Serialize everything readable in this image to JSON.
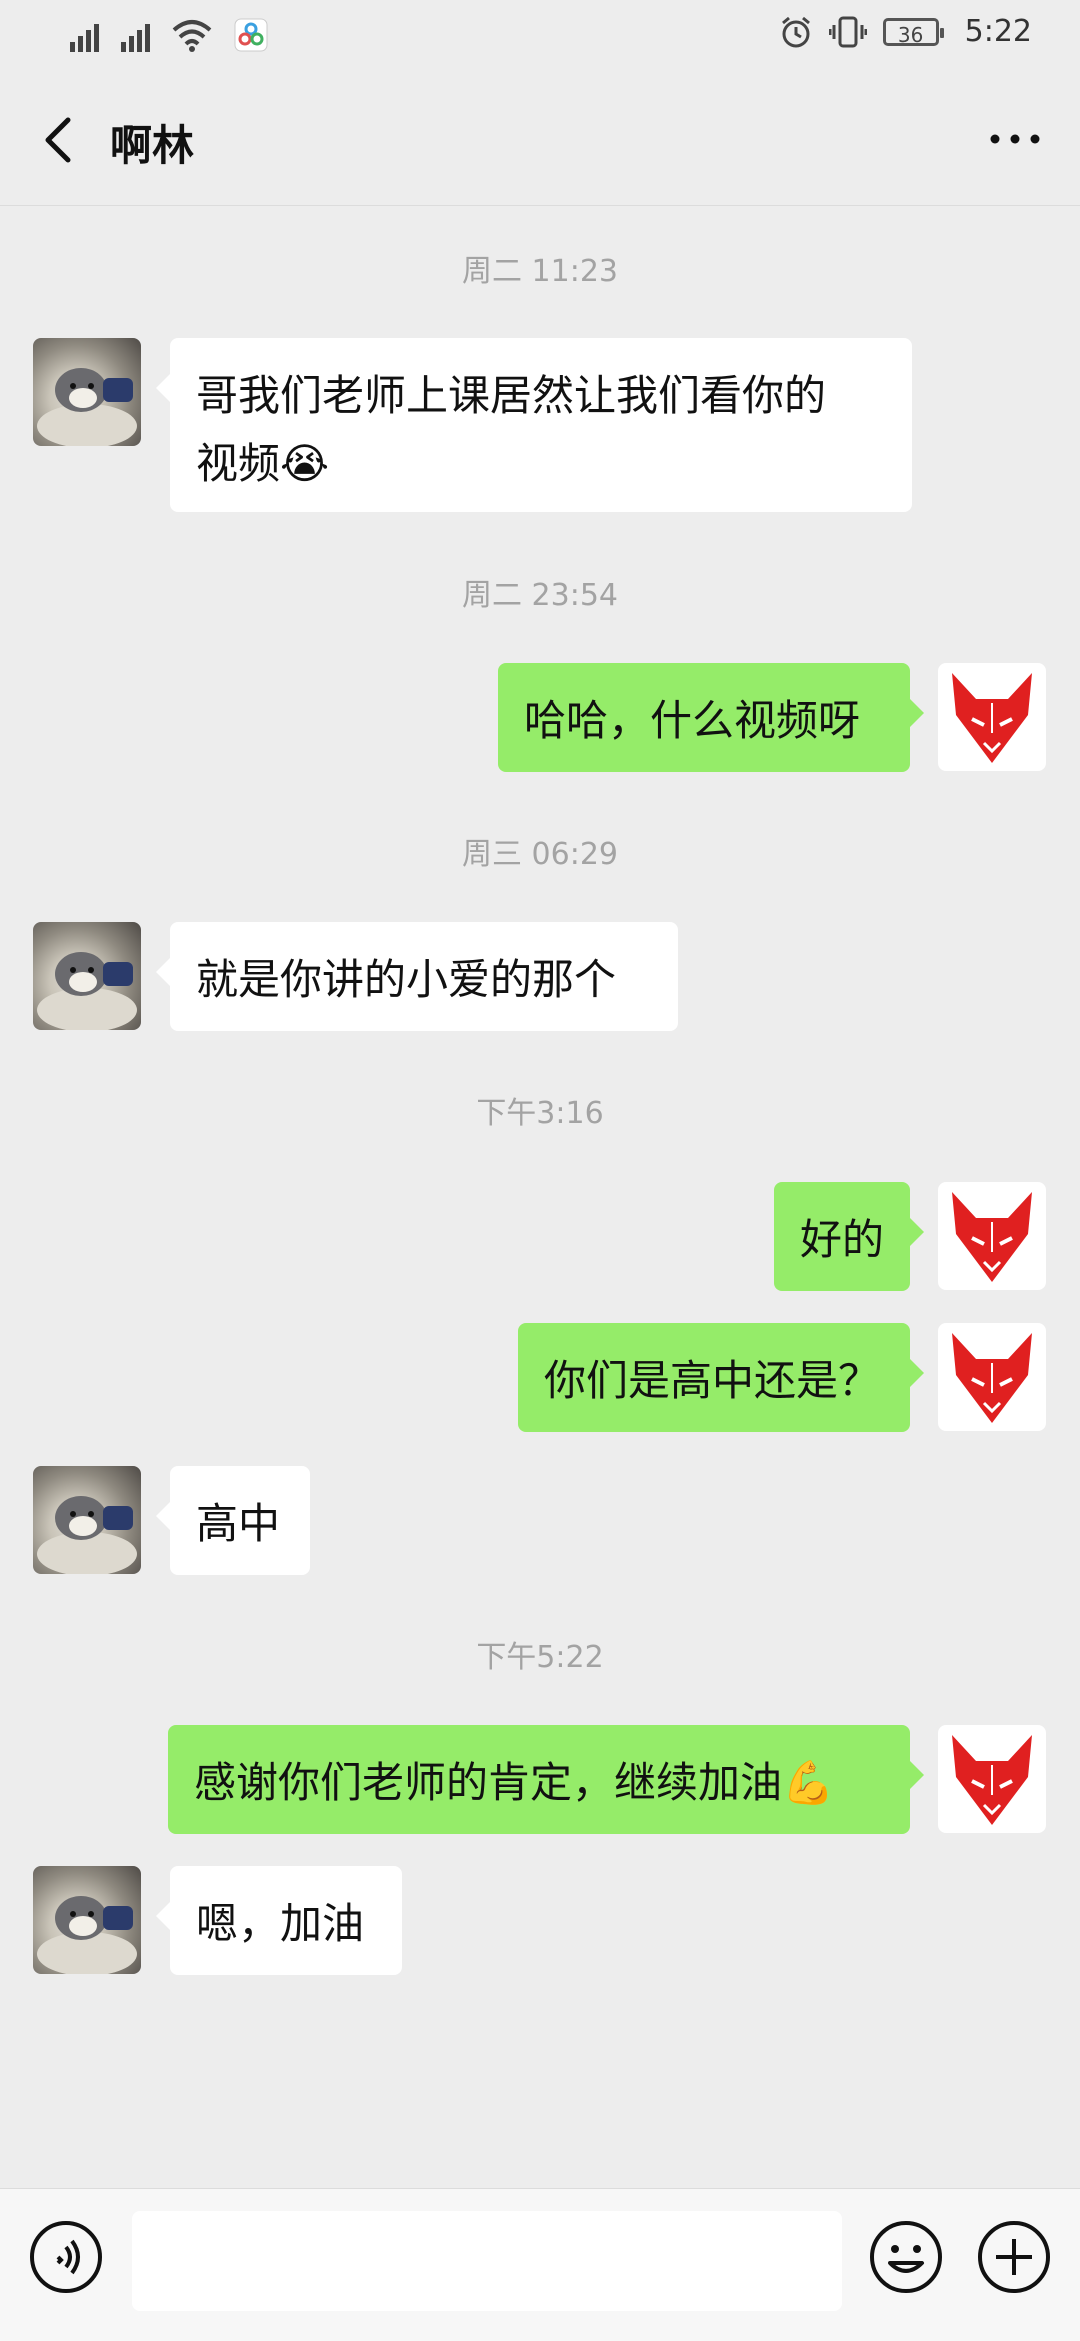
{
  "status": {
    "time": "5:22",
    "battery": "36"
  },
  "header": {
    "title": "啊林"
  },
  "timestamps": [
    "周二 11:23",
    "周二 23:54",
    "周三 06:29",
    "下午3:16",
    "下午5:22"
  ],
  "messages": [
    {
      "side": "left",
      "line1": "哥我们老师上课居然让我们看你的",
      "line2": "视频",
      "emoji": "😭"
    },
    {
      "side": "right",
      "text": "哈哈，什么视频呀"
    },
    {
      "side": "left",
      "text": "就是你讲的小爱的那个"
    },
    {
      "side": "right",
      "text": "好的"
    },
    {
      "side": "right",
      "text": "你们是高中还是？"
    },
    {
      "side": "left",
      "text": "高中"
    },
    {
      "side": "right",
      "text": "感谢你们老师的肯定，继续加油",
      "emoji": "💪"
    },
    {
      "side": "left",
      "text": "嗯，加油"
    }
  ],
  "colors": {
    "sent_bubble": "#95ec69",
    "received_bubble": "#ffffff",
    "background": "#ededed",
    "fox": "#e02020"
  },
  "icons": [
    "signal-icon",
    "wifi-icon",
    "app-notification-icon",
    "alarm-icon",
    "vibrate-icon",
    "battery-icon",
    "back-icon",
    "more-icon",
    "voice-icon",
    "emoji-icon",
    "plus-icon"
  ],
  "input": {
    "value": ""
  }
}
